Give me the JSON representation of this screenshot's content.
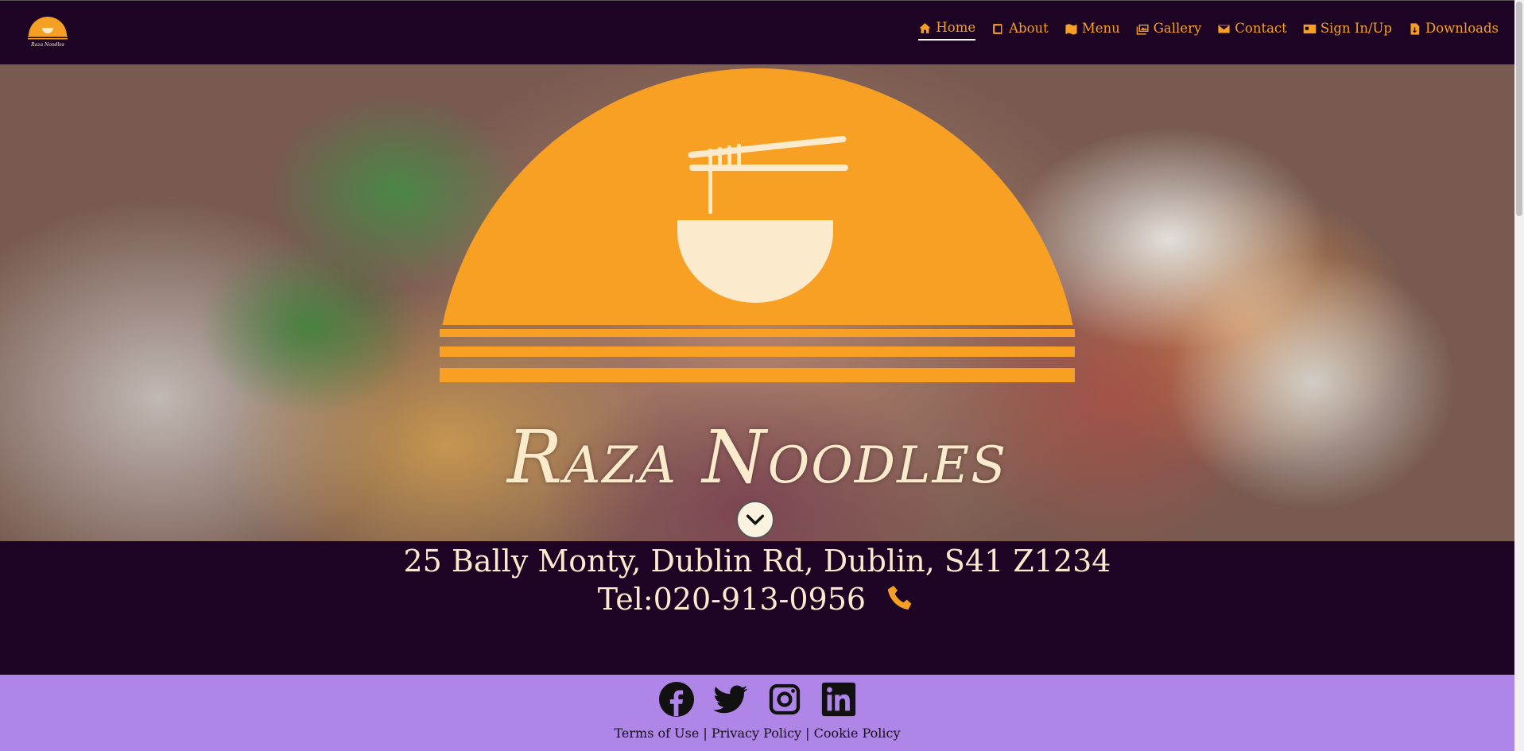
{
  "nav": {
    "logo_text": "Raza Noodles",
    "links": [
      {
        "label": "Home",
        "icon": "home-icon",
        "active": true
      },
      {
        "label": "About",
        "icon": "book-icon"
      },
      {
        "label": "Menu",
        "icon": "map-icon"
      },
      {
        "label": "Gallery",
        "icon": "images-icon"
      },
      {
        "label": "Contact",
        "icon": "envelope-icon"
      },
      {
        "label": "Sign In/Up",
        "icon": "id-card-icon"
      },
      {
        "label": "Downloads",
        "icon": "file-download-icon"
      }
    ]
  },
  "hero": {
    "title": "Raza Noodles",
    "emblem_icon": "noodle-bowl-icon",
    "scroll_icon": "chevron-down-icon"
  },
  "address": {
    "line": "25 Bally Monty, Dublin Rd, Dublin, S41 Z1234",
    "phone": "Tel:020-913-0956",
    "phone_icon": "phone-icon"
  },
  "footer": {
    "social": [
      "facebook-icon",
      "twitter-icon",
      "instagram-icon",
      "linkedin-icon"
    ],
    "terms": "Terms of Use",
    "privacy": "Privacy Policy",
    "cookie": "Cookie Policy",
    "separator": "|"
  },
  "colors": {
    "background": "#1d0424",
    "accent": "#f5a024",
    "cream": "#fbeacb",
    "footer": "#b085e8"
  }
}
